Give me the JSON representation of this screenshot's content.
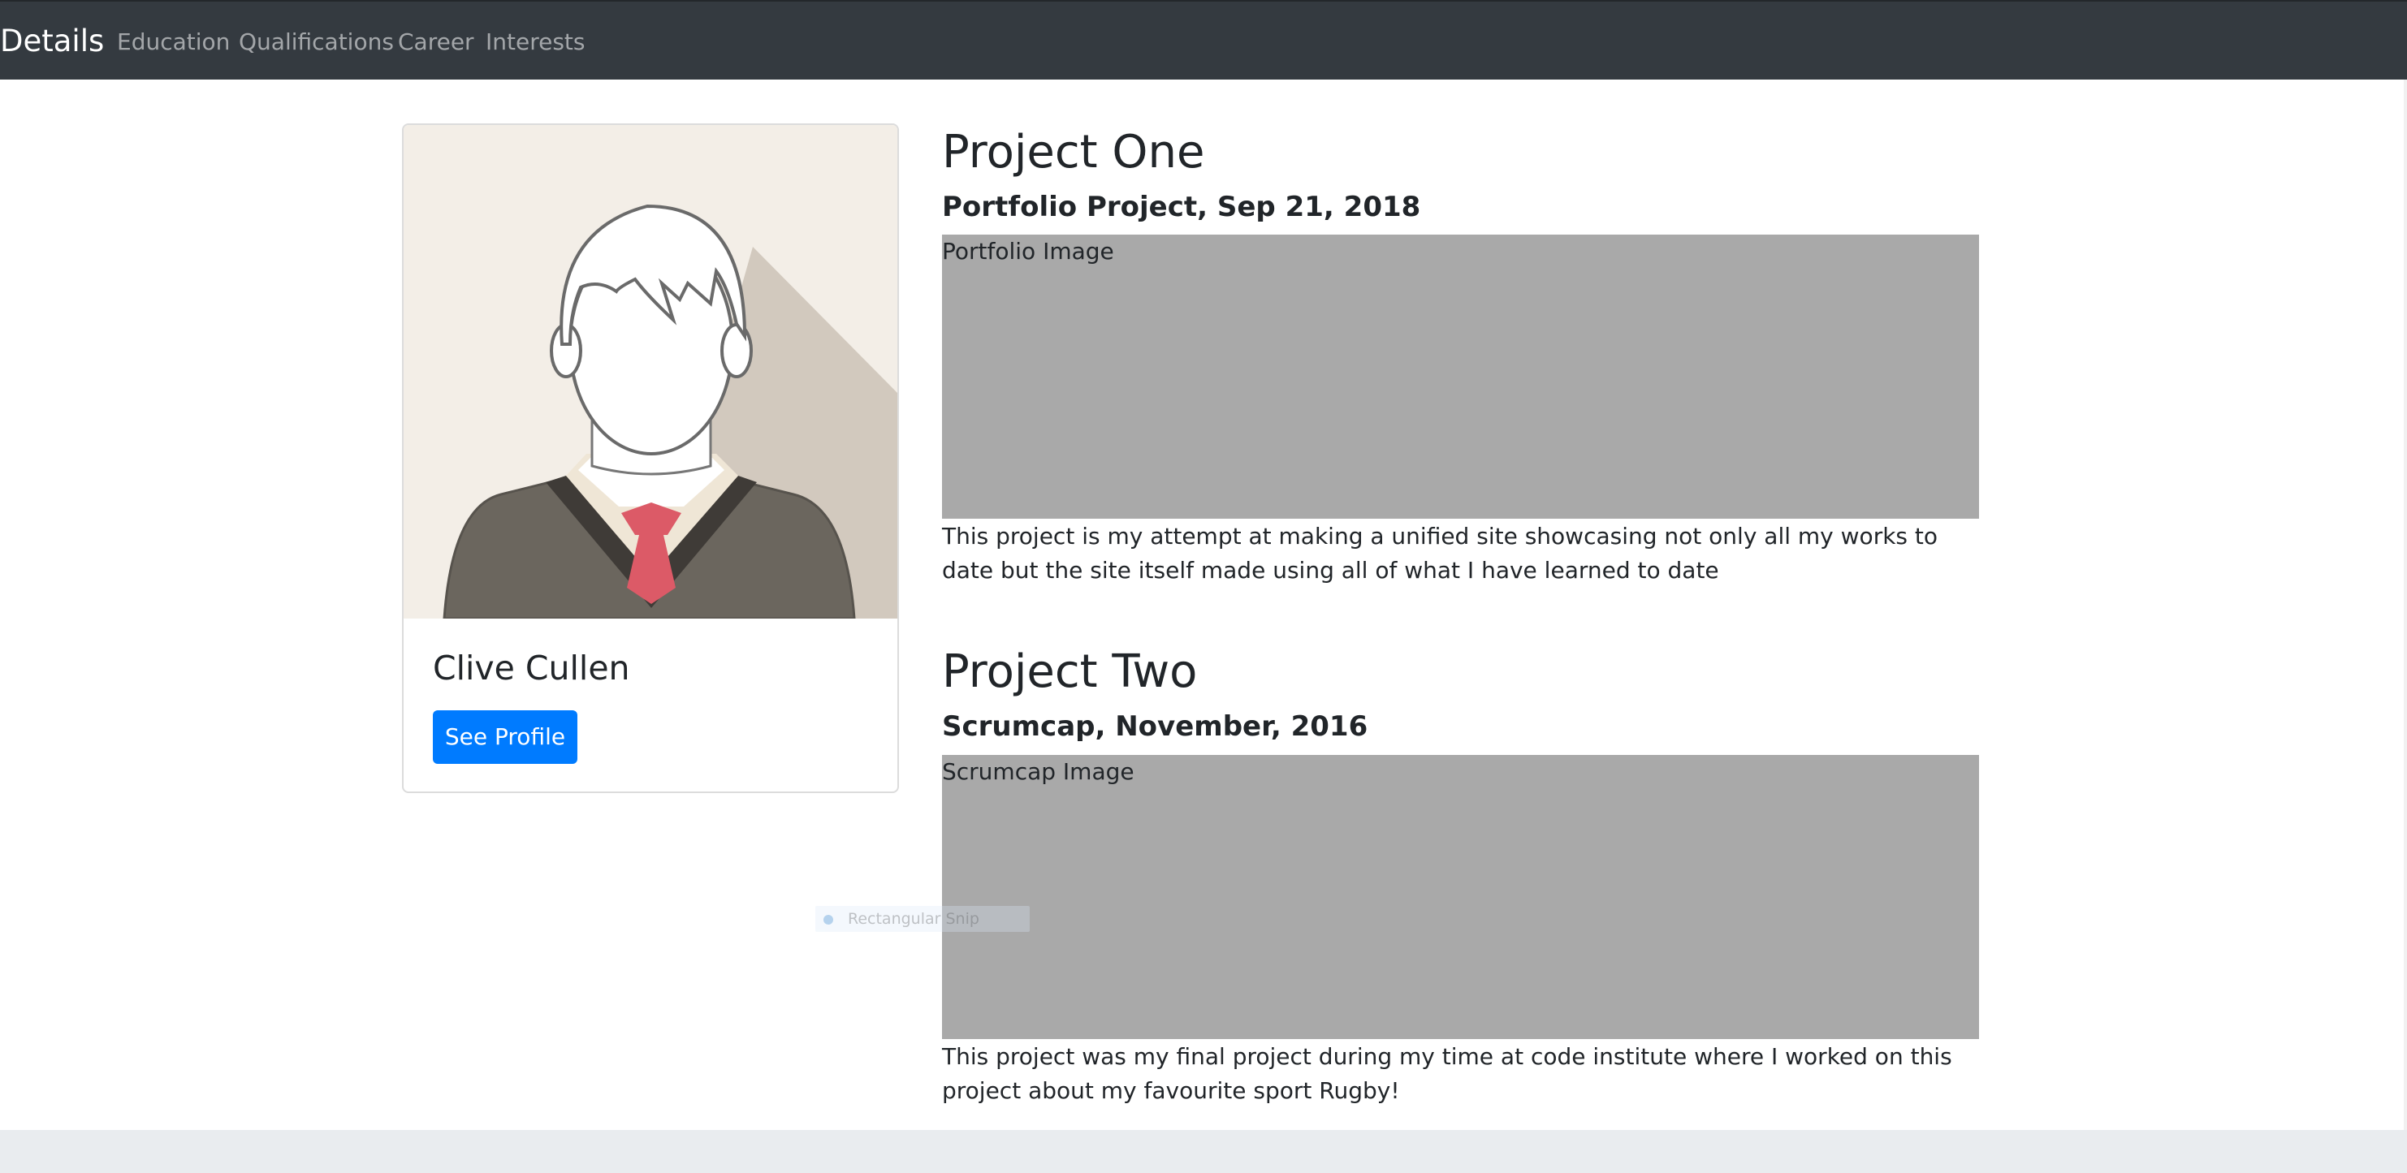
{
  "navbar": {
    "brand": "Details",
    "items": [
      {
        "label": "Education"
      },
      {
        "label": "Qualifications"
      },
      {
        "label": "Career"
      },
      {
        "label": "Interests"
      }
    ]
  },
  "profile": {
    "name": "Clive Cullen",
    "button_label": "See Profile",
    "avatar_icon": "person-avatar-icon"
  },
  "projects": [
    {
      "title": "Project One",
      "subtitle": "Portfolio Project, Sep 21, 2018",
      "image_alt": "Portfolio Image",
      "description": "This project is my attempt at making a unified site showcasing not only all my works to date but the site itself made using all of what I have learned to date"
    },
    {
      "title": "Project Two",
      "subtitle": "Scrumcap, November, 2016",
      "image_alt": "Scrumcap Image",
      "description": "This project was my final project during my time at code institute where I worked on this project about my favourite sport Rugby!"
    }
  ],
  "overlay": {
    "snip_label": "Rectangular Snip"
  },
  "colors": {
    "navbar": "#343a40",
    "accent": "#007bff",
    "image_placeholder": "#a9a9a9",
    "footer": "#e9ecef"
  }
}
